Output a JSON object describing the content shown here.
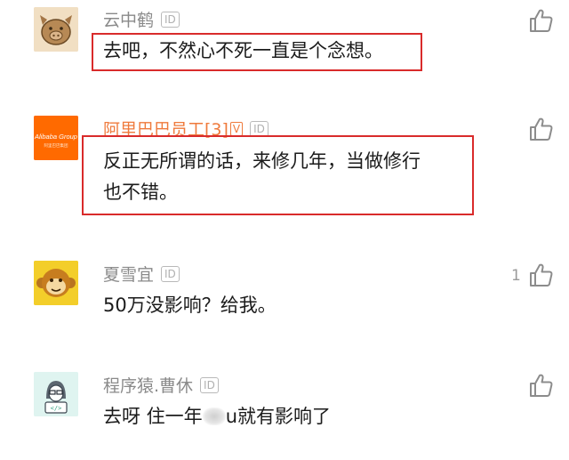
{
  "comments": [
    {
      "name": "云中鹤",
      "id_badge": "ID",
      "text": "去吧，不然心不死一直是个念想。",
      "likes": ""
    },
    {
      "name": "阿里巴巴员工[3]",
      "id_badge": "ID",
      "level_badge": "V",
      "text_line1": "反正无所谓的话，来修几年，当做修行",
      "text_line2": "也不错。",
      "likes": "",
      "avatar_logo": "Alibaba Group",
      "avatar_logo_cn": "阿里巴巴集团"
    },
    {
      "name": "夏雪宜",
      "id_badge": "ID",
      "text": "50万没影响？给我。",
      "likes": "1"
    },
    {
      "name": "程序猿.曹休",
      "id_badge": "ID",
      "text_before": "去呀 住一年",
      "text_after": "u就有影响了",
      "likes": "",
      "avatar_code": "</>"
    }
  ],
  "colors": {
    "highlight": "#d92b2b",
    "alibaba_orange": "#ff6a00",
    "name_gray": "#8a8a8a"
  },
  "icons": [
    "thumbs-up-icon"
  ]
}
